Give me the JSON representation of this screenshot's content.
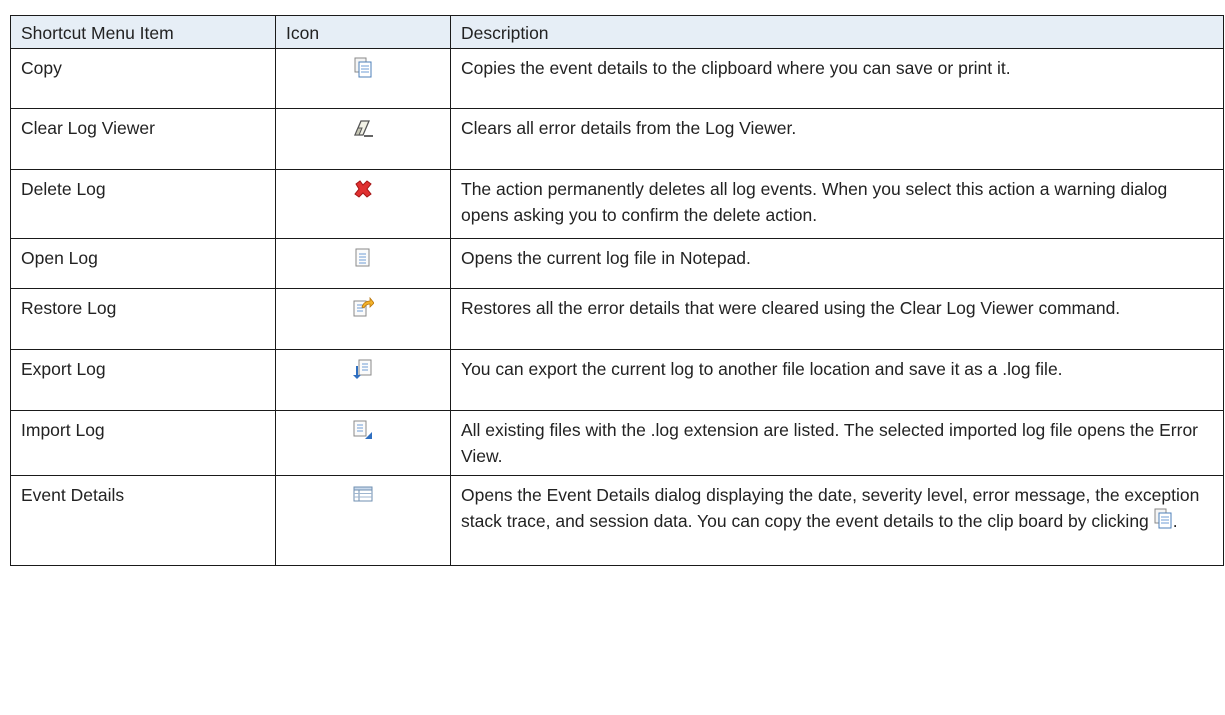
{
  "table": {
    "headers": [
      "Shortcut  Menu Item",
      "Icon",
      "Description"
    ],
    "rows": [
      {
        "item": "Copy",
        "icon": "copy-icon",
        "description": "Copies the event details to the clipboard where you can save or print it."
      },
      {
        "item": "Clear Log Viewer",
        "icon": "eraser-icon",
        "description": "Clears all error details from the Log Viewer."
      },
      {
        "item": "Delete Log",
        "icon": "delete-x-icon",
        "description": "The action permanently deletes all log events. When you select this action a warning dialog opens asking you to confirm the delete action."
      },
      {
        "item": "Open Log",
        "icon": "document-icon",
        "description": "Opens the current log file in Notepad."
      },
      {
        "item": "Restore Log",
        "icon": "restore-log-icon",
        "description": "Restores all the error details that were cleared using the Clear Log Viewer command."
      },
      {
        "item": "Export Log",
        "icon": "export-log-icon",
        "description": "You can export the current log to another file location and save it as a .log file."
      },
      {
        "item": "Import Log",
        "icon": "import-log-icon",
        "description": " All existing files with the .log extension are listed. The selected imported log file opens the Error View."
      },
      {
        "item": "Event Details",
        "icon": "table-details-icon",
        "description": "Opens the Event Details dialog displaying the date, severity level, error message, the exception stack trace, and session data. You can copy the event details to the clip board by clicking",
        "trailing": "."
      }
    ]
  }
}
